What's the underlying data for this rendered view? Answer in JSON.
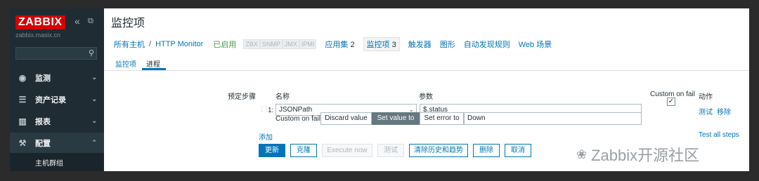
{
  "sidebar": {
    "logo": "ZABBIX",
    "collapse_icon": "«",
    "expand_icon": "⧉",
    "domain": "zabbix.masix.cn",
    "search_placeholder": "",
    "menu": [
      {
        "label": "监测",
        "icon": "eye-icon",
        "glyph": "◉",
        "arrow": "⌄"
      },
      {
        "label": "资产记录",
        "icon": "list-icon",
        "glyph": "☰",
        "arrow": "⌄"
      },
      {
        "label": "报表",
        "icon": "chart-icon",
        "glyph": "▥",
        "arrow": "⌄"
      },
      {
        "label": "配置",
        "icon": "wrench-icon",
        "glyph": "🔧",
        "arrow": "⌃"
      }
    ],
    "submenu_item": "主机群组"
  },
  "header": {
    "title": "监控项"
  },
  "nav": {
    "all_hosts": "所有主机",
    "separator": "/",
    "host": "HTTP Monitor",
    "status": "已启用",
    "protocols": [
      "ZBX",
      "SNMP",
      "JMX",
      "IPMI"
    ],
    "applications": "应用集",
    "applications_count": "2",
    "items": "监控项",
    "items_count": "3",
    "triggers": "触发器",
    "graphs": "图形",
    "discovery": "自动发现规则",
    "web": "Web 场景"
  },
  "tabs": {
    "item": "监控项",
    "preprocessing": "进程"
  },
  "form": {
    "steps_label": "预定步骤",
    "col_name": "名称",
    "col_params": "参数",
    "col_custom_on_fail": "Custom on fail",
    "col_actions": "动作",
    "step_number": "1:",
    "step_type": "JSONPath",
    "step_param": "$.status",
    "custom_on_fail_checked": true,
    "check_glyph": "✓",
    "test_link": "测试",
    "remove_link": "移除",
    "custom_on_fail_label": "Custom on fail",
    "fail_options": [
      "Discard value",
      "Set value to",
      "Set error to"
    ],
    "fail_selected": "Set value to",
    "fail_value": "Down",
    "add_link": "添加",
    "test_all_link": "Test all steps"
  },
  "buttons": {
    "update": "更新",
    "clone": "克隆",
    "execute_now": "Execute now",
    "test": "测试",
    "clear_history": "清除历史和趋势",
    "delete": "删除",
    "cancel": "取消"
  },
  "watermark": {
    "text": "Zabbix开源社区",
    "icon": "wechat-icon"
  },
  "colors": {
    "brand": "#d40000",
    "link": "#0275b8",
    "sidebar": "#1f2c33",
    "enabled": "#429e47"
  }
}
